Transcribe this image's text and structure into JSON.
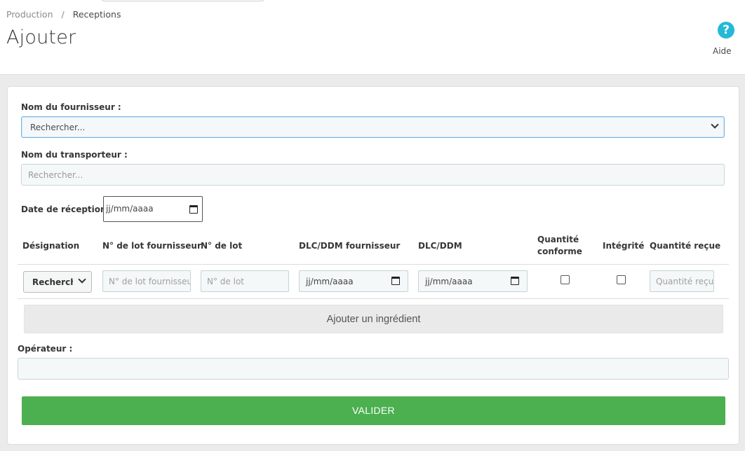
{
  "breadcrumb": {
    "parent": "Production",
    "separator": "/",
    "current": "Receptions"
  },
  "page": {
    "title": "Ajouter"
  },
  "help": {
    "label": "Aide",
    "icon": "help-circle-icon",
    "glyph": "?"
  },
  "form": {
    "supplier": {
      "label": "Nom du fournisseur :",
      "value": "Rechercher..."
    },
    "carrier": {
      "label": "Nom du transporteur :",
      "placeholder": "Rechercher..."
    },
    "reception_date": {
      "label": "Date de réception :",
      "value": "jj/mm/aaaa"
    }
  },
  "ingredients_table": {
    "headers": {
      "designation": "Désignation",
      "supplier_lot": "N° de lot fournisseur",
      "lot": "N° de lot",
      "dlc_supplier": "DLC/DDM fournisseur",
      "dlc": "DLC/DDM",
      "quantity_ok_1": "Quantité",
      "quantity_ok_2": "conforme",
      "integrity": "Intégrité",
      "quantity_received": "Quantité reçue"
    },
    "row": {
      "designation_value": "Rechercher...",
      "supplier_lot_placeholder": "N° de lot fournisseur",
      "lot_placeholder": "N° de lot",
      "dlc_supplier_value": "jj/mm/aaaa",
      "dlc_value": "jj/mm/aaaa",
      "quantity_ok_checked": false,
      "integrity_checked": false,
      "quantity_received_placeholder": "Quantité reçue"
    }
  },
  "add_ingredient_label": "Ajouter un ingrédient",
  "operator": {
    "label": "Opérateur :",
    "value": ""
  },
  "submit_label": "VALIDER",
  "colors": {
    "accent": "#25b9d7",
    "submit": "#4caf50"
  }
}
